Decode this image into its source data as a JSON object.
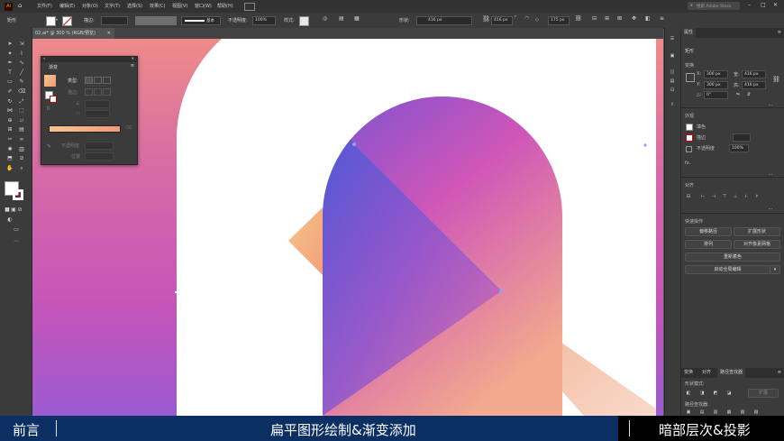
{
  "menubar": {
    "app_logo": "Ai",
    "items": [
      "文件(F)",
      "编辑(E)",
      "对象(O)",
      "文字(T)",
      "选择(S)",
      "效果(C)",
      "视图(V)",
      "窗口(W)",
      "帮助(H)"
    ],
    "search_placeholder": "搜索 Adobe Stock",
    "window_controls": [
      "–",
      "□",
      "✕"
    ]
  },
  "control_bar": {
    "selection_label": "矩形",
    "stroke_label": "描边:",
    "stroke_style": "基本",
    "opacity_label": "不透明度:",
    "opacity_value": "100%",
    "style_label": "样式:",
    "shape_label": "形状:",
    "width_value": "416 px",
    "height_value": "416 px",
    "corner_value": "175 px"
  },
  "document_tab": {
    "title": "02.ai* @ 300 % (RGB/预览)",
    "close": "✕"
  },
  "gradient_panel": {
    "title": "渐变",
    "type_label": "类型:",
    "stroke_label": "描边:",
    "opacity_label": "不透明度",
    "location_label": "位置",
    "angle_value": "",
    "ratio_value": ""
  },
  "properties_panel": {
    "tabs": [
      "属性"
    ],
    "shape_name": "矩形",
    "transform_label": "变换",
    "x_label": "X:",
    "x_value": "300 px",
    "y_label": "Y:",
    "y_value": "300 px",
    "w_label": "宽:",
    "w_value": "416 px",
    "h_label": "高:",
    "h_value": "416 px",
    "angle_label": "△:",
    "angle_value": "0°",
    "appearance_label": "外观",
    "fill_label": "填色",
    "stroke_label": "描边",
    "opacity_label": "不透明度",
    "opacity_value": "100%",
    "fx_label": "fx.",
    "align_label": "对齐",
    "quick_actions_label": "快速操作",
    "buttons": {
      "offset_path": "偏移路径",
      "expand_shape": "扩展形状",
      "arrange": "排列",
      "align_pixel_grid": "对齐像素网格",
      "recolor": "重新着色",
      "start_global_edit": "启动全局编辑"
    }
  },
  "pathfinder_panel": {
    "tabs": [
      "变换",
      "对齐",
      "路径查找器"
    ],
    "shape_modes_label": "形状模式:",
    "pathfinders_label": "路径查找器:",
    "expand_button": "扩展"
  },
  "caption_bar": {
    "left": "前言",
    "center": "扁平图形绘制&渐变添加",
    "right": "暗部层次&投影"
  },
  "colors": {
    "gradient_purple": "#7a55d6",
    "gradient_pink": "#cf55b3",
    "gradient_peach": "#f5b38c",
    "caption_blue": "#0b2f63"
  }
}
